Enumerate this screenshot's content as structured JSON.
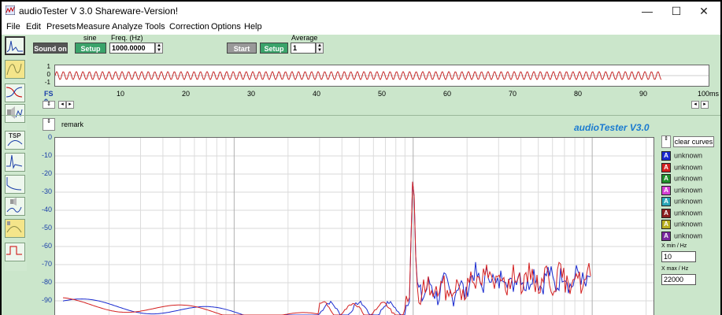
{
  "window": {
    "title": "audioTester  V 3.0 Shareware-Version!",
    "controls": [
      "—",
      "☐",
      "✕"
    ]
  },
  "menu": [
    "File",
    "Edit",
    "Presets",
    "Measure",
    "Analyze",
    "Tools",
    "Correction",
    "Options",
    "Help"
  ],
  "toolbar": {
    "sound_on": "Sound on",
    "sine_label": "sine",
    "setup": "Setup",
    "freq_label": "Freq. (Hz)",
    "freq_value": "1000.0000",
    "start": "Start",
    "setup2": "Setup",
    "average_label": "Average",
    "average_value": "1"
  },
  "oscilloscope": {
    "y_labels": [
      "1",
      "0",
      "-1"
    ],
    "x_labels": [
      "FS 0",
      "10",
      "20",
      "30",
      "40",
      "50",
      "60",
      "70",
      "80",
      "90",
      "100ms"
    ]
  },
  "spectrum": {
    "remark": "remark",
    "brand": "audioTester  V3.0",
    "y_labels": [
      "0",
      "-10",
      "-20",
      "-30",
      "-40",
      "-50",
      "-60",
      "-70",
      "-80",
      "-90"
    ],
    "clear_curves": "clear curves",
    "curves": [
      {
        "letter": "A",
        "label": "unknown",
        "color": "#1a2bd0"
      },
      {
        "letter": "A",
        "label": "unknown",
        "color": "#d42020"
      },
      {
        "letter": "A",
        "label": "unknown",
        "color": "#1f8f2a"
      },
      {
        "letter": "A",
        "label": "unknown",
        "color": "#d43fd4"
      },
      {
        "letter": "A",
        "label": "unknown",
        "color": "#2aa7b8"
      },
      {
        "letter": "A",
        "label": "unknown",
        "color": "#8a1f1f"
      },
      {
        "letter": "A",
        "label": "unknown",
        "color": "#b8b020"
      },
      {
        "letter": "A",
        "label": "unknown",
        "color": "#7a2aa0"
      }
    ],
    "xmin_label": "X min / Hz",
    "xmin_value": "10",
    "xmax_label": "X max / Hz",
    "xmax_value": "22000"
  },
  "left_tools": [
    "spectrum-tool-icon",
    "filter-tool-icon",
    "frequency-response-tool-icon",
    "speaker-tool-icon",
    "tsp-tool-icon",
    "impulse-tool-icon",
    "step-response-tool-icon",
    "speaker-impedance-tool-icon",
    "speaker-dbm-tool-icon",
    "waveform-tool-icon"
  ],
  "tool_tsp_label": "TSP"
}
